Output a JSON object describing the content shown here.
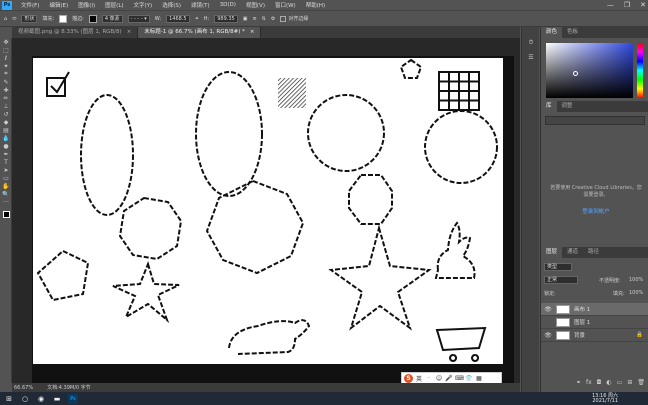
{
  "menubar": {
    "app_icon": "Ps",
    "items": [
      "文件(F)",
      "编辑(E)",
      "图像(I)",
      "图层(L)",
      "文字(Y)",
      "选择(S)",
      "滤镜(T)",
      "3D(D)",
      "视图(V)",
      "窗口(W)",
      "帮助(H)"
    ],
    "minimize": "—",
    "restore": "❐",
    "close": "✕"
  },
  "options": {
    "shape_mode": "形状",
    "fill_label": "填充:",
    "stroke_label": "描边:",
    "stroke_width": "4 像素",
    "w_label": "W:",
    "w_value": "1468.5",
    "h_label": "H:",
    "h_value": "989.35",
    "align_label": "对齐边缘"
  },
  "tabs": [
    {
      "label": "视频截图.png @ 8.33% (图层 1, RGB/8)",
      "close": "×"
    },
    {
      "label": "未标题-1 @ 66.7% (画布 1, RGB/8#) *",
      "close": "×"
    }
  ],
  "status": {
    "zoom": "66.67%",
    "doc": "文档:4.39M/0 字节"
  },
  "ime": {
    "logo": "S",
    "items": [
      "英",
      "·",
      "☺",
      "🎤",
      "⌨",
      "👕",
      "▦"
    ]
  },
  "color_panel": {
    "tabs": [
      "颜色",
      "色板"
    ]
  },
  "libraries": {
    "tabs": [
      "库",
      "调整"
    ],
    "message": "若要使用 Creative Cloud Libraries，您需要登录。",
    "link": "登录到帐户"
  },
  "layers_panel": {
    "tabs": [
      "图层",
      "通道",
      "路径"
    ],
    "kind": "类型",
    "blend": "正常",
    "opacity_label": "不透明度:",
    "opacity": "100%",
    "lock_label": "锁定:",
    "fill_label": "填充:",
    "fill": "100%",
    "layers": [
      {
        "name": "画布 1",
        "selected": true
      },
      {
        "name": "图层 1",
        "selected": false
      },
      {
        "name": "背景",
        "selected": false
      }
    ]
  },
  "taskbar": {
    "time": "13:16 周六",
    "date": "2021/7/11"
  },
  "tools": [
    "move",
    "marquee",
    "lasso",
    "magic-wand",
    "crop",
    "eyedropper",
    "heal",
    "brush",
    "stamp",
    "history",
    "eraser",
    "gradient",
    "blur",
    "dodge",
    "pen",
    "type",
    "path-select",
    "shape",
    "hand",
    "zoom",
    "more",
    "fg-bg"
  ]
}
